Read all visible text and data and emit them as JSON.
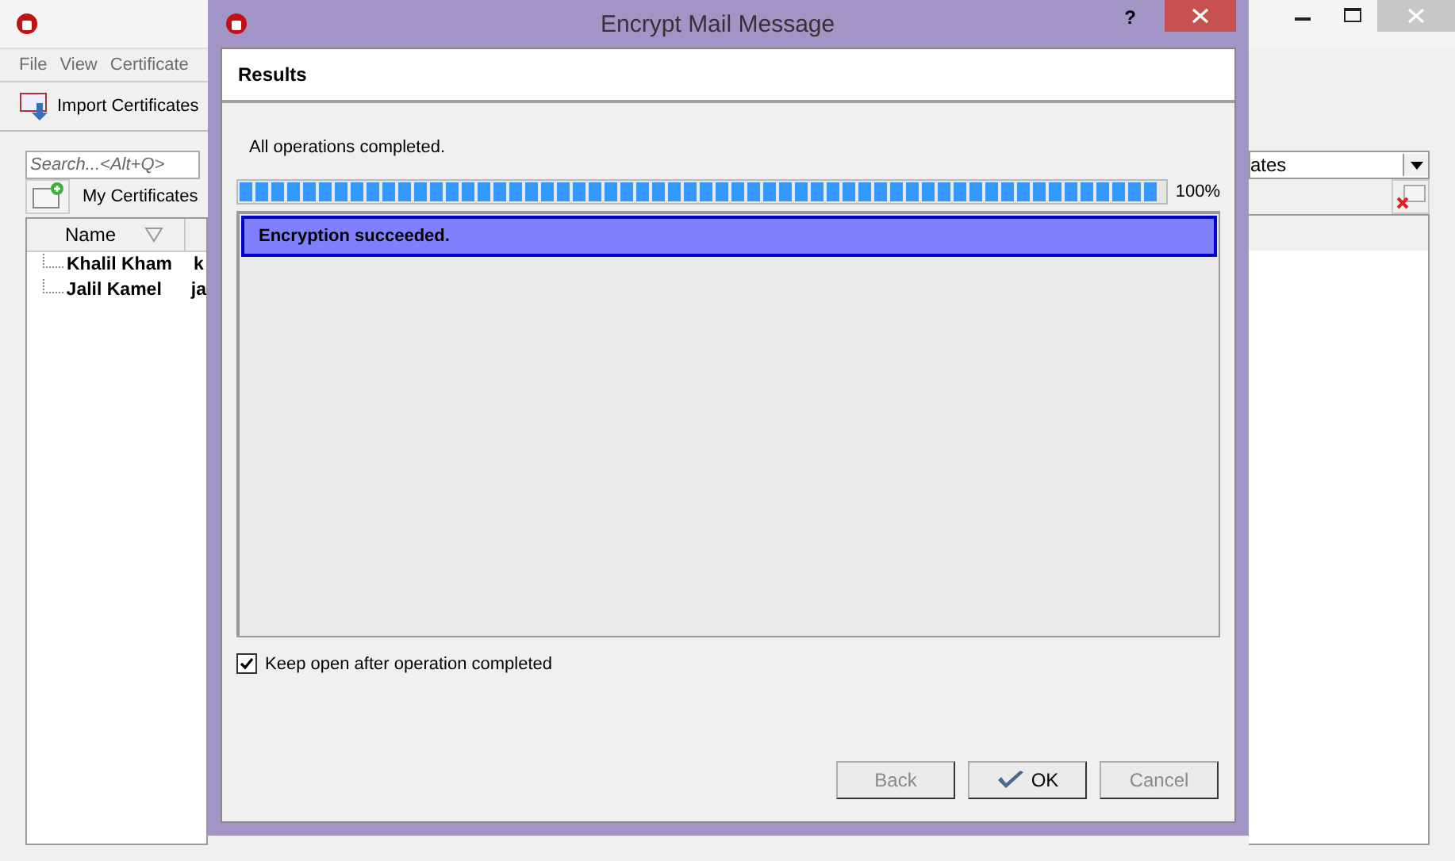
{
  "app": {
    "menu": [
      "File",
      "View",
      "Certificate"
    ],
    "toolbar": [
      {
        "label": "Import Certificates"
      }
    ],
    "search": {
      "placeholder": "Search...<Alt+Q>"
    },
    "filter": {
      "value": "ates"
    },
    "tabs": [
      {
        "label": "My Certificates",
        "selected": true
      }
    ],
    "table": {
      "columns": [
        "Name"
      ],
      "rows": [
        [
          "Khalil Kham",
          "k"
        ],
        [
          "Jalil Kamel",
          "ja"
        ]
      ]
    }
  },
  "dialog": {
    "title": "Encrypt Mail Message",
    "help": "?",
    "header": "Results",
    "status": "All operations completed.",
    "progress": {
      "level": 1,
      "reading": "100%"
    },
    "results": [
      {
        "text": "Encryption succeeded.",
        "selected": true
      }
    ],
    "keep_open": {
      "label": "Keep open after operation completed",
      "checked": true
    },
    "buttons": [
      {
        "label": "Back",
        "disabled": true,
        "kind": "plain"
      },
      {
        "label": "OK",
        "disabled": false,
        "kind": "ok"
      },
      {
        "label": "Cancel",
        "disabled": true,
        "kind": "plain"
      }
    ]
  }
}
